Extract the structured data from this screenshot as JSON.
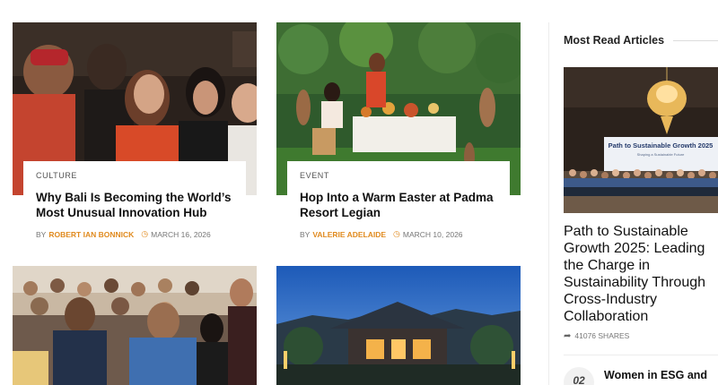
{
  "articles": [
    {
      "category": "CULTURE",
      "title": "Why Bali Is Becoming the World’s Most Unusual Innovation Hub",
      "by": "BY",
      "author": "ROBERT IAN BONNICK",
      "date": "MARCH 16, 2026"
    },
    {
      "category": "EVENT",
      "title": "Hop Into a Warm Easter at Padma Resort Legian",
      "by": "BY",
      "author": "VALERIE ADELAIDE",
      "date": "MARCH 10, 2026"
    }
  ],
  "sidebar": {
    "heading": "Most Read Articles",
    "featured": {
      "slide_title": "Path to Sustainable Growth 2025",
      "slide_subtitle": "Shaping a Sustainable Future",
      "title": "Path to Sustainable Growth 2025: Leading the Charge in Sustainability Through Cross-Industry Collaboration",
      "shares": "41076 SHARES"
    },
    "second": {
      "number": "02",
      "title": "Women in ESG and"
    }
  },
  "icons": {
    "clock": "clock-icon",
    "share": "share-icon"
  },
  "colors": {
    "accent": "#e08a1e"
  }
}
